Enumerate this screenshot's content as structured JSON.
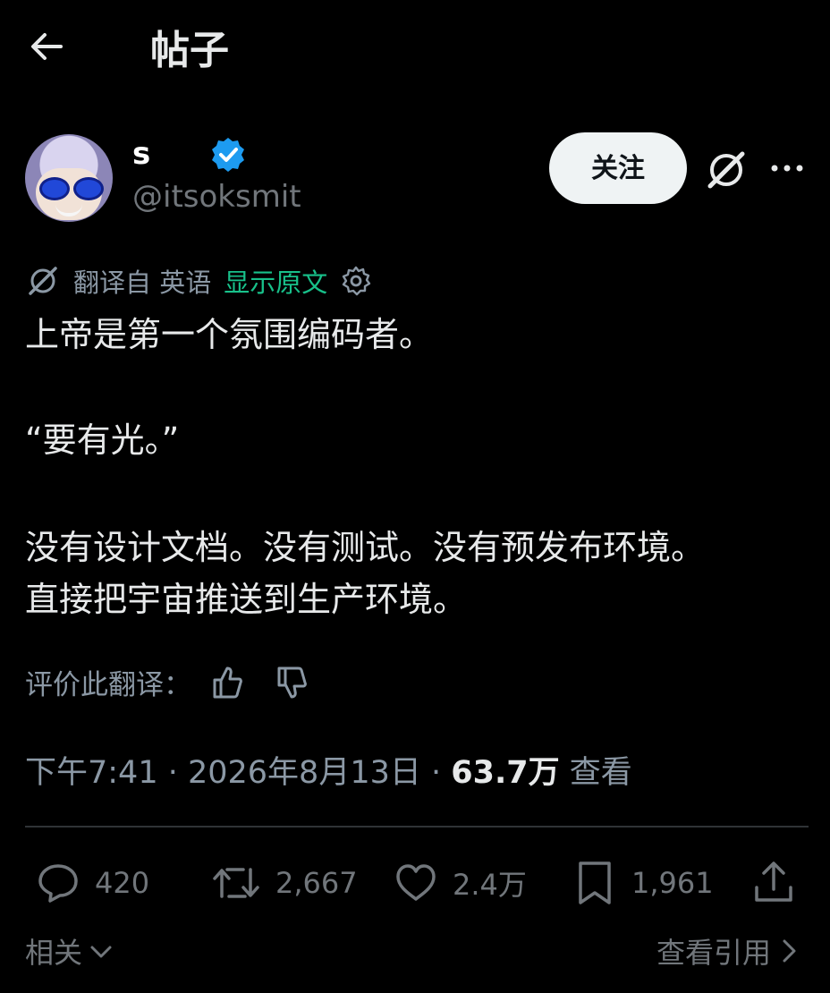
{
  "header": {
    "title": "帖子"
  },
  "author": {
    "display_name": "s",
    "handle": "@itsoksmit",
    "follow_label": "关注"
  },
  "translation": {
    "source_label": "翻译自 英语",
    "show_original": "显示原文"
  },
  "post": {
    "line1": "上帝是第一个氛围编码者。",
    "line2": "“要有光。”",
    "line3": "没有设计文档。没有测试。没有预发布环境。",
    "line4": "直接把宇宙推送到生产环境。"
  },
  "rate": {
    "label": "评价此翻译："
  },
  "meta": {
    "time_date": "下午7:41 · 2026年8月13日 · ",
    "views": "63.7万",
    "views_label": " 查看"
  },
  "actions": {
    "replies": "420",
    "reposts": "2,667",
    "likes": "2.4万",
    "bookmarks": "1,961"
  },
  "footer": {
    "related": "相关",
    "quotes": "查看引用"
  },
  "colors": {
    "accent_green": "#18c08a",
    "verified_blue": "#1d9bf0",
    "muted": "#71767b"
  }
}
